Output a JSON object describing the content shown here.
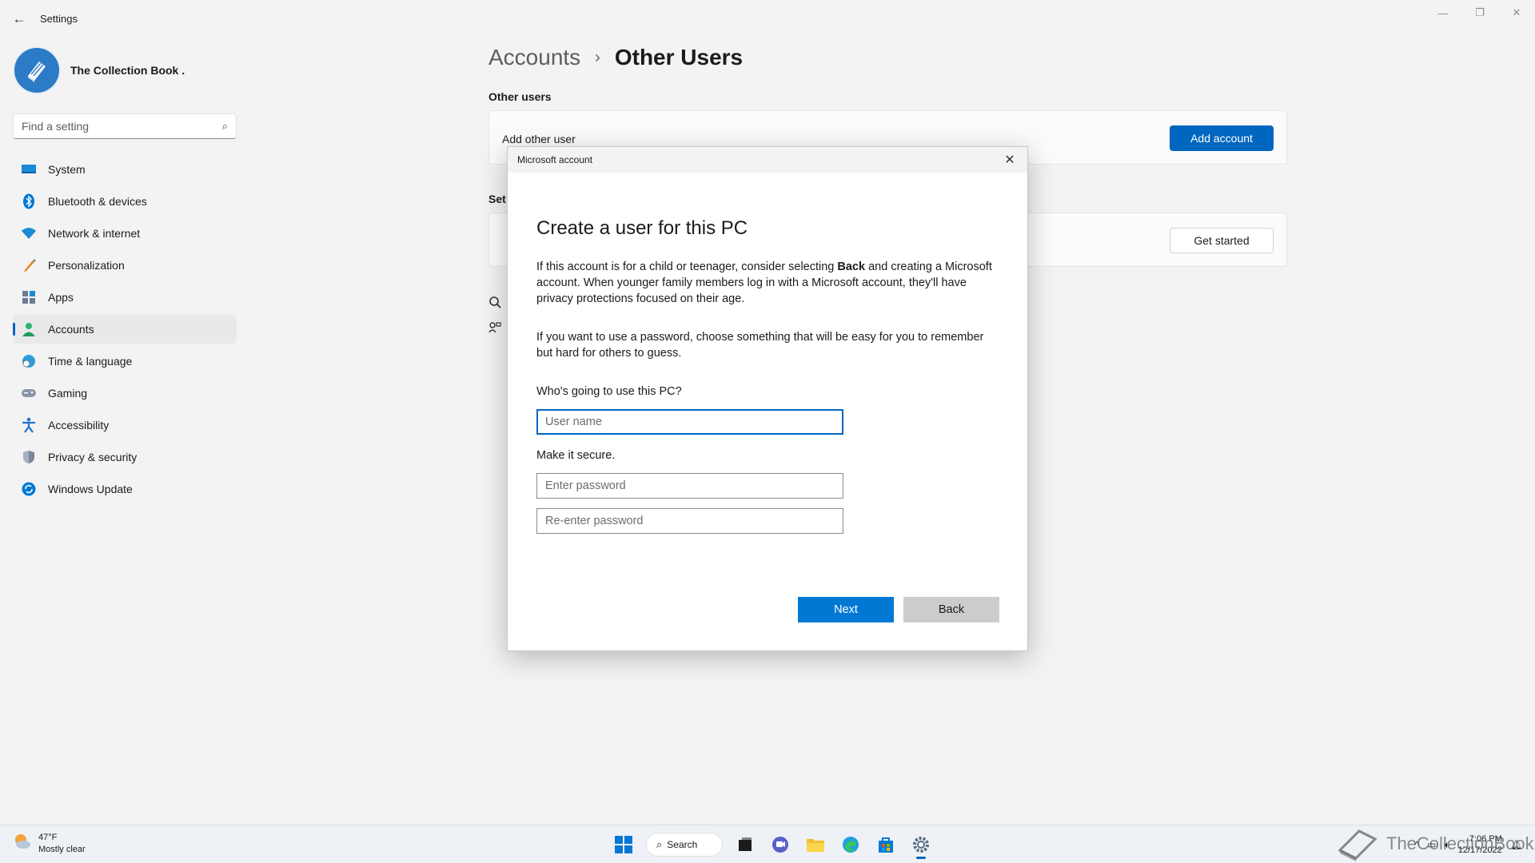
{
  "app": {
    "title": "Settings"
  },
  "window_controls": {
    "minimize": "—",
    "restore": "❐",
    "close": "✕"
  },
  "profile": {
    "name": "The Collection Book ."
  },
  "search": {
    "placeholder": "Find a setting"
  },
  "nav": {
    "items": [
      {
        "label": "System",
        "icon": "system-icon",
        "color": "#0078d4"
      },
      {
        "label": "Bluetooth & devices",
        "icon": "bluetooth-icon",
        "color": "#0078d4"
      },
      {
        "label": "Network & internet",
        "icon": "wifi-icon",
        "color": "#0078d4"
      },
      {
        "label": "Personalization",
        "icon": "brush-icon",
        "color": "#e8871e"
      },
      {
        "label": "Apps",
        "icon": "apps-icon",
        "color": "#6b7b93"
      },
      {
        "label": "Accounts",
        "icon": "person-icon",
        "color": "#2bb673"
      },
      {
        "label": "Time & language",
        "icon": "clock-globe-icon",
        "color": "#2b9cd8"
      },
      {
        "label": "Gaming",
        "icon": "gamepad-icon",
        "color": "#6b7b93"
      },
      {
        "label": "Accessibility",
        "icon": "accessibility-icon",
        "color": "#1976d2"
      },
      {
        "label": "Privacy & security",
        "icon": "shield-icon",
        "color": "#6b7b93"
      },
      {
        "label": "Windows Update",
        "icon": "update-icon",
        "color": "#0078d4"
      }
    ],
    "active_index": 5
  },
  "main": {
    "breadcrumb_parent": "Accounts",
    "breadcrumb_separator": "›",
    "breadcrumb_current": "Other Users",
    "section_label": "Other users",
    "add_other_user_label": "Add other user",
    "add_account_button": "Add account",
    "section2_label_partial": "Set",
    "get_started_button": "Get started"
  },
  "dialog": {
    "title": "Microsoft account",
    "close": "✕",
    "heading": "Create a user for this PC",
    "para1_before": "If this account is for a child or teenager, consider selecting ",
    "para1_bold": "Back",
    "para1_after": " and creating a Microsoft account. When younger family members log in with a Microsoft account, they'll have privacy protections focused on their age.",
    "para2": "If you want to use a password, choose something that will be easy for you to remember but hard for others to guess.",
    "who_label": "Who's going to use this PC?",
    "username_placeholder": "User name",
    "secure_label": "Make it secure.",
    "password_placeholder": "Enter password",
    "reenter_placeholder": "Re-enter password",
    "next_button": "Next",
    "back_button": "Back"
  },
  "taskbar": {
    "weather_temp": "47°F",
    "weather_desc": "Mostly clear",
    "search_label": "Search",
    "time": "7:06 PM",
    "date": "12/17/2022"
  },
  "watermark": {
    "text": "TheCollectionBook"
  },
  "colors": {
    "accent": "#0067c0",
    "button_blue": "#0078d4"
  }
}
